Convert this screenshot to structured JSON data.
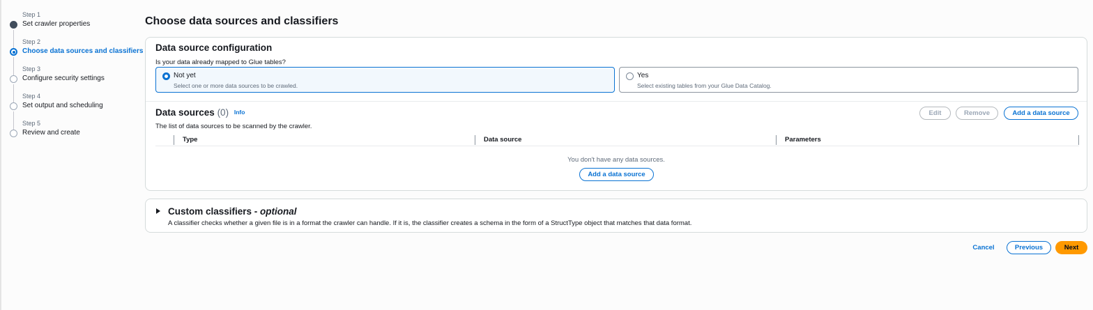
{
  "steps": [
    {
      "num": "Step 1",
      "label": "Set crawler properties",
      "state": "done"
    },
    {
      "num": "Step 2",
      "label": "Choose data sources and classifiers",
      "state": "active"
    },
    {
      "num": "Step 3",
      "label": "Configure security settings",
      "state": "pending"
    },
    {
      "num": "Step 4",
      "label": "Set output and scheduling",
      "state": "pending"
    },
    {
      "num": "Step 5",
      "label": "Review and create",
      "state": "pending"
    }
  ],
  "page_title": "Choose data sources and classifiers",
  "config": {
    "title": "Data source configuration",
    "question": "Is your data already mapped to Glue tables?",
    "options": [
      {
        "title": "Not yet",
        "desc": "Select one or more data sources to be crawled.",
        "selected": true
      },
      {
        "title": "Yes",
        "desc": "Select existing tables from your Glue Data Catalog.",
        "selected": false
      }
    ]
  },
  "data_sources": {
    "title": "Data sources",
    "count": "(0)",
    "info": "Info",
    "desc": "The list of data sources to be scanned by the crawler.",
    "buttons": {
      "edit": "Edit",
      "remove": "Remove",
      "add": "Add a data source"
    },
    "columns": [
      "Type",
      "Data source",
      "Parameters"
    ],
    "empty_text": "You don't have any data sources.",
    "empty_add": "Add a data source"
  },
  "classifiers": {
    "title": "Custom classifiers - ",
    "title_optional": "optional",
    "desc": "A classifier checks whether a given file is in a format the crawler can handle. If it is, the classifier creates a schema in the form of a StructType object that matches that data format."
  },
  "footer": {
    "cancel": "Cancel",
    "previous": "Previous",
    "next": "Next"
  },
  "colors": {
    "accent": "#0972d3",
    "primary": "#ff9900"
  }
}
